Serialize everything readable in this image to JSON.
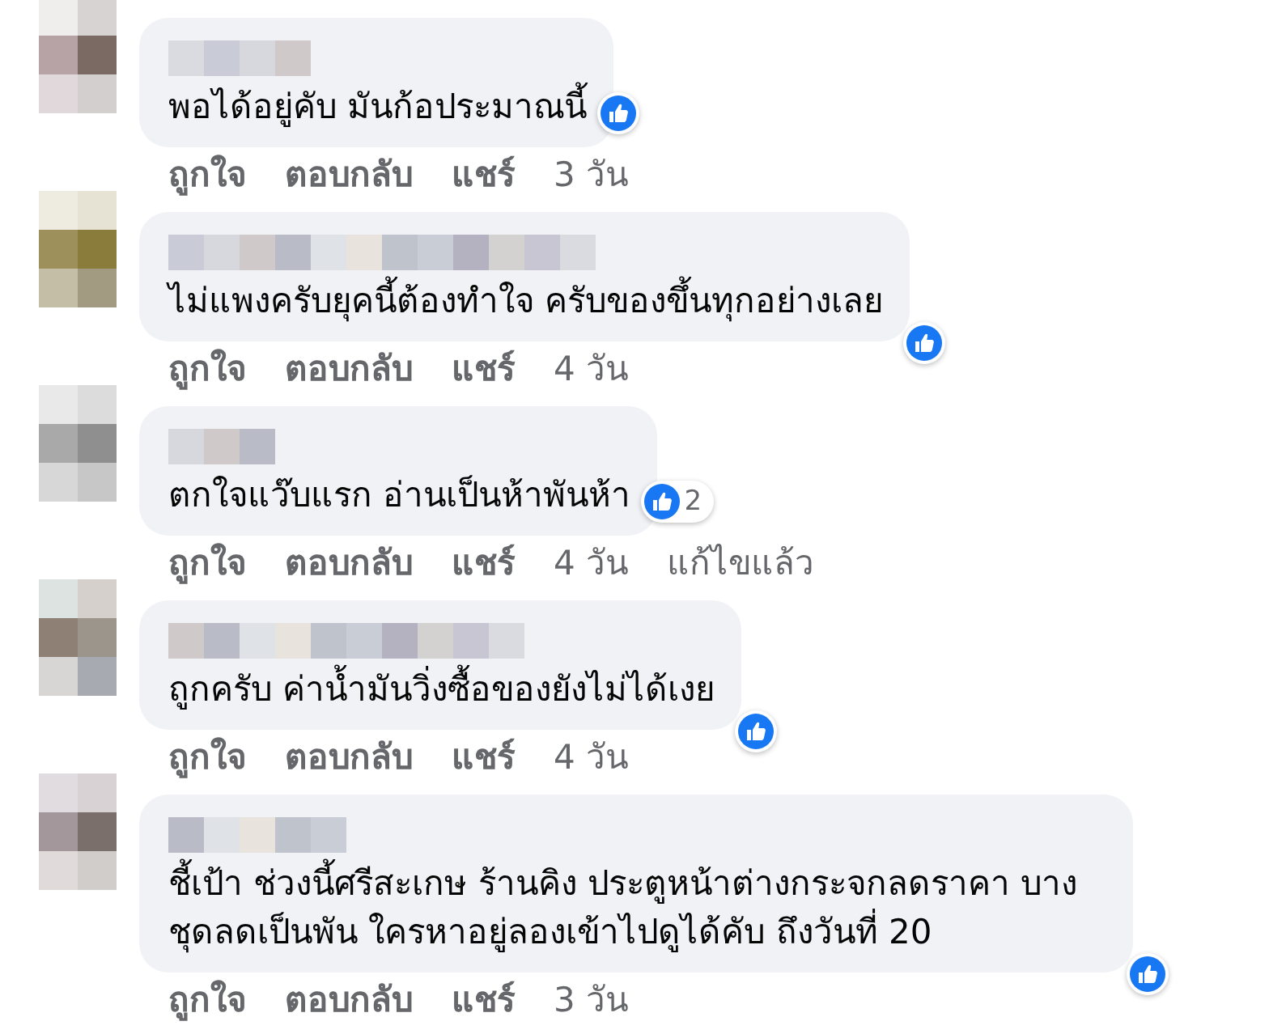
{
  "comments": [
    {
      "text": "พอได้อยู่คับ มันก้อประมาณนี้",
      "reaction": {
        "kind": "side"
      },
      "actions": [
        {
          "label": "ถูกใจ",
          "kind": "action"
        },
        {
          "label": "ตอบกลับ",
          "kind": "action"
        },
        {
          "label": "แชร์",
          "kind": "action"
        },
        {
          "label": "3 วัน",
          "kind": "meta"
        }
      ]
    },
    {
      "text": "ไม่แพงครับยุคนี้ต้องทำใจ ครับของขึ้นทุกอย่างเลย",
      "reaction": {
        "kind": "corner"
      },
      "actions": [
        {
          "label": "ถูกใจ",
          "kind": "action"
        },
        {
          "label": "ตอบกลับ",
          "kind": "action"
        },
        {
          "label": "แชร์",
          "kind": "action"
        },
        {
          "label": "4 วัน",
          "kind": "meta"
        }
      ]
    },
    {
      "text": "ตกใจแว๊บแรก อ่านเป็นห้าพันห้า",
      "reaction": {
        "kind": "side",
        "count": "2"
      },
      "actions": [
        {
          "label": "ถูกใจ",
          "kind": "action"
        },
        {
          "label": "ตอบกลับ",
          "kind": "action"
        },
        {
          "label": "แชร์",
          "kind": "action"
        },
        {
          "label": "4 วัน",
          "kind": "meta"
        },
        {
          "label": "แก้ไขแล้ว",
          "kind": "meta"
        }
      ]
    },
    {
      "text": "ถูกครับ ค่าน้ำมันวิ่งซื้อของยังไม่ได้เงย",
      "reaction": {
        "kind": "corner"
      },
      "actions": [
        {
          "label": "ถูกใจ",
          "kind": "action"
        },
        {
          "label": "ตอบกลับ",
          "kind": "action"
        },
        {
          "label": "แชร์",
          "kind": "action"
        },
        {
          "label": "4 วัน",
          "kind": "meta"
        }
      ]
    },
    {
      "text": "ชี้เป้า ช่วงนี้ศรีสะเกษ ร้านคิง ประตูหน้าต่างกระจกลดราคา บาง ชุดลดเป็นพัน ใครหาอยู่ลองเข้าไปดูได้คับ ถึงวันที่ 20",
      "reaction": {
        "kind": "corner"
      },
      "actions": [
        {
          "label": "ถูกใจ",
          "kind": "action"
        },
        {
          "label": "ตอบกลับ",
          "kind": "action"
        },
        {
          "label": "แชร์",
          "kind": "action"
        },
        {
          "label": "3 วัน",
          "kind": "meta"
        }
      ]
    }
  ]
}
